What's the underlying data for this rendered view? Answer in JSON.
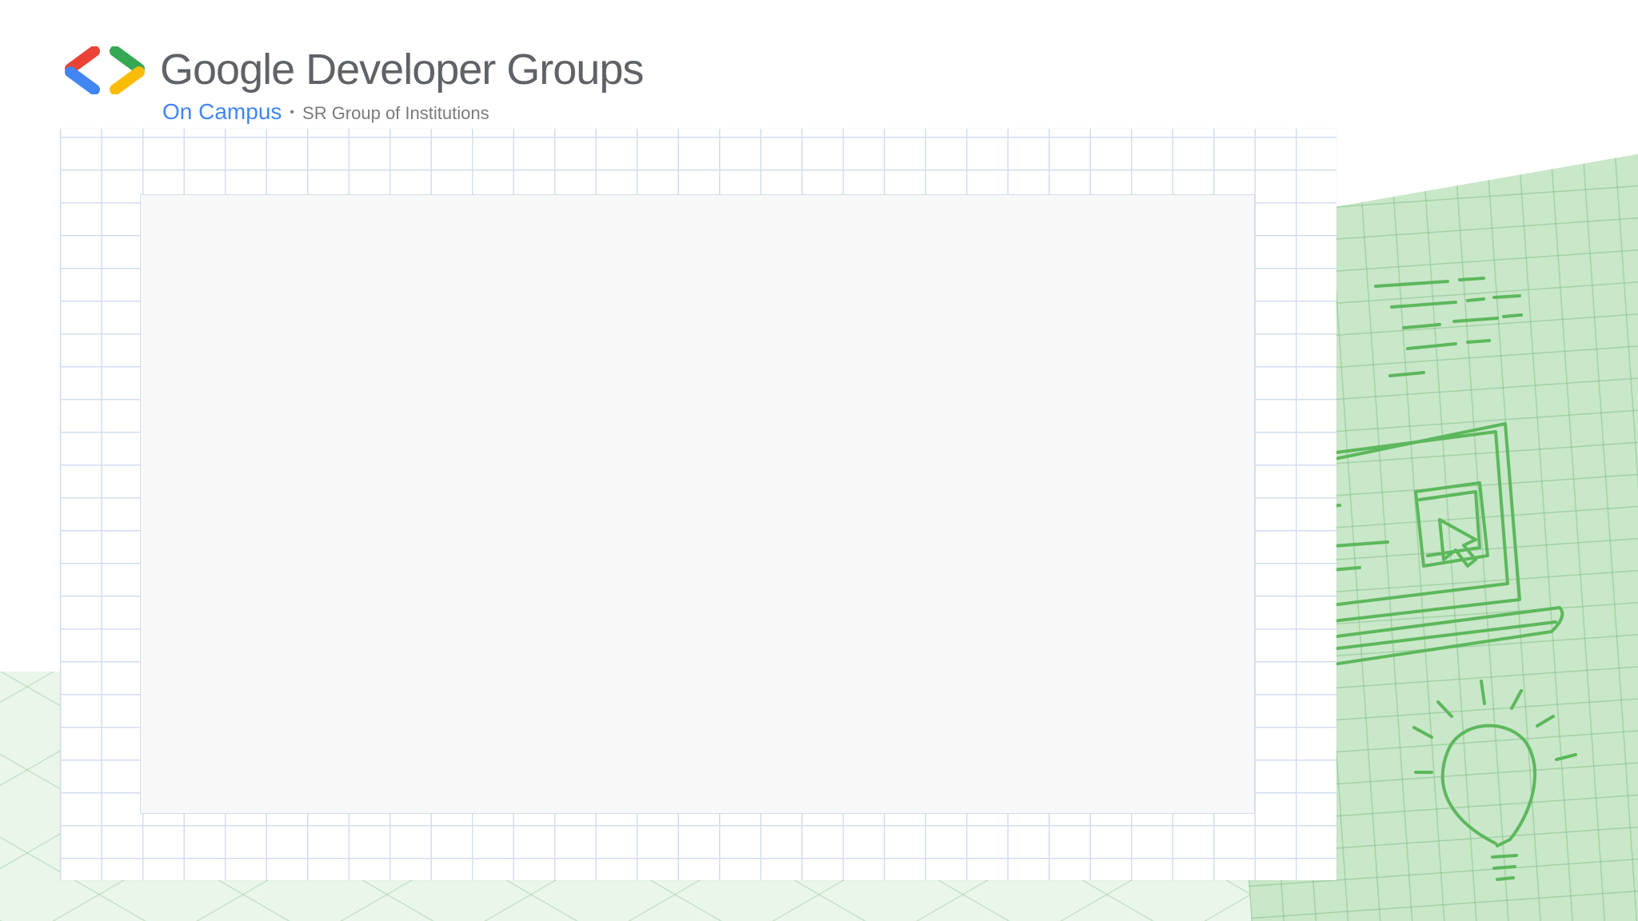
{
  "header": {
    "title": "Google Developer Groups",
    "subtitle_campus": "On Campus",
    "separator": "•",
    "subtitle_institution": "SR Group of Institutions"
  },
  "icons": {
    "brand_mark": "gdg-brackets-logo-icon",
    "laptop_sketch": "laptop-cursor-sketch-icon",
    "lightbulb_sketch": "lightbulb-sketch-icon",
    "text_lines_sketch": "text-lines-sketch-icon"
  },
  "colors": {
    "google_blue": "#4285f4",
    "google_red": "#ea4335",
    "google_green": "#34a853",
    "google_yellow": "#fbbc04",
    "sheet_green": "#c9e7c9",
    "sketch_green": "#5cb85c",
    "grid_blue": "#d3ddf2",
    "title_gray": "#5f6368"
  }
}
